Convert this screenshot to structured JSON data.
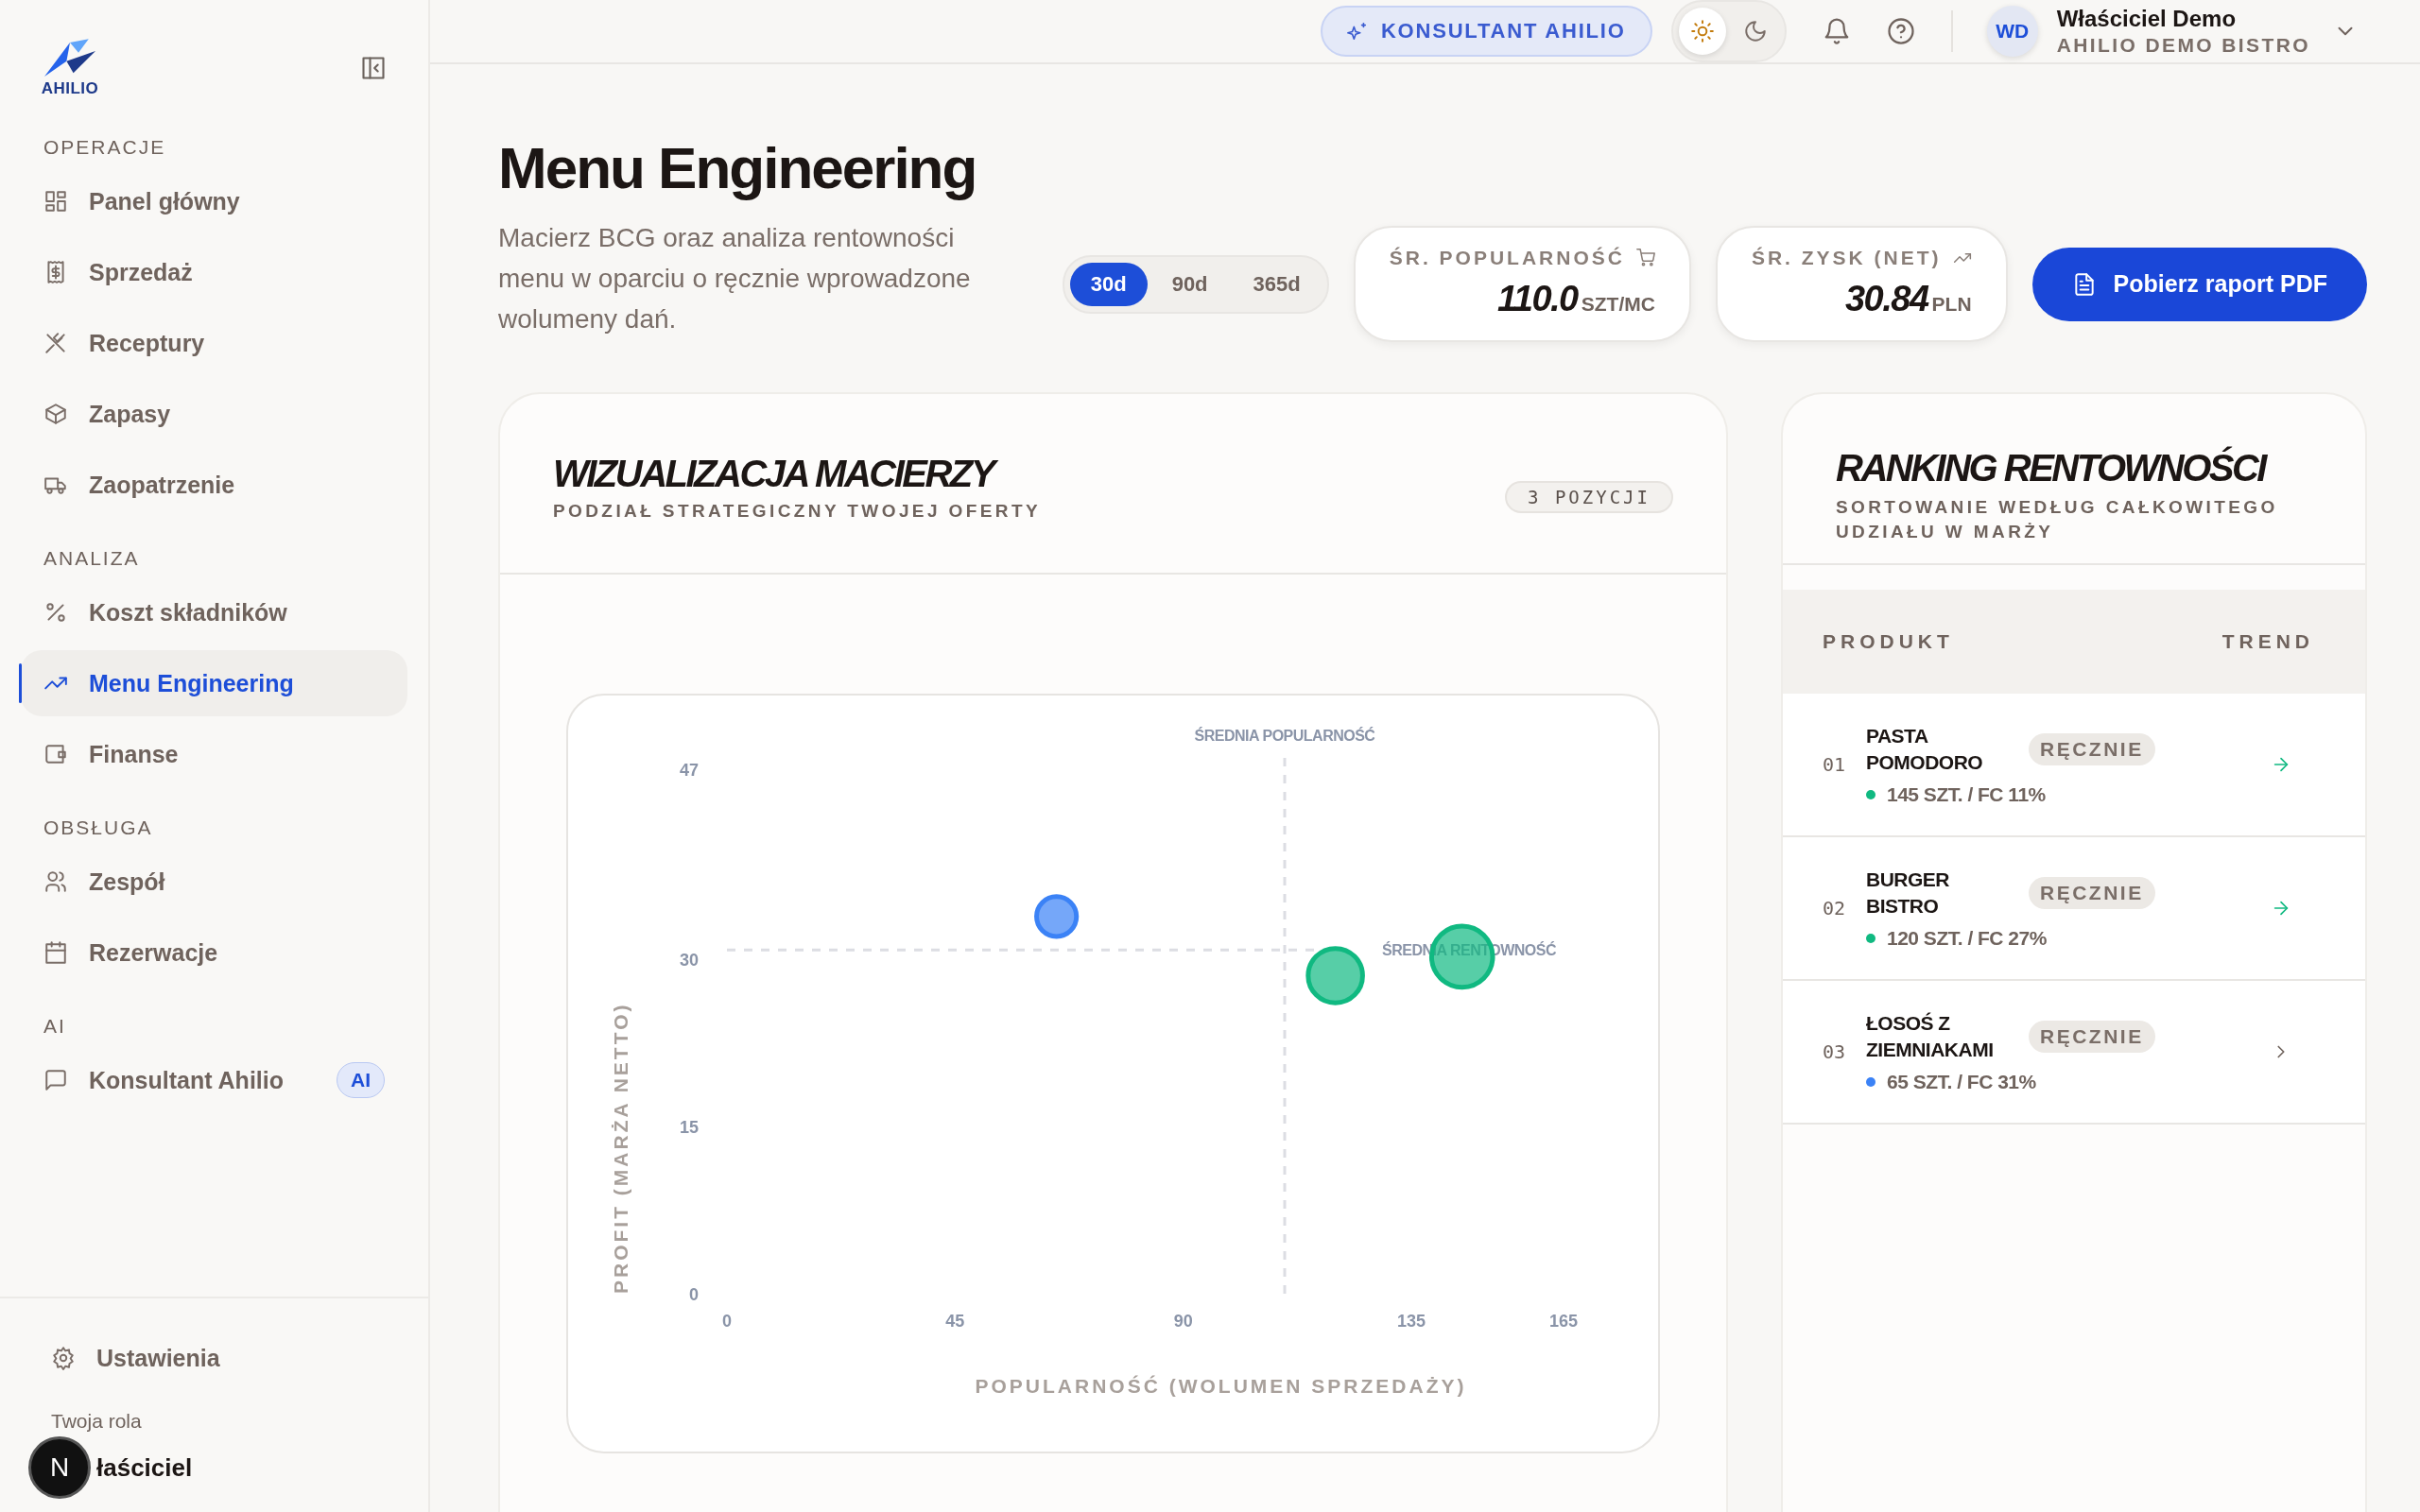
{
  "sidebar": {
    "logo": "AHILIO",
    "sections": [
      {
        "title": "OPERACJE",
        "items": [
          {
            "label": "Panel główny",
            "selected": false
          },
          {
            "label": "Sprzedaż",
            "selected": false
          },
          {
            "label": "Receptury",
            "selected": false
          },
          {
            "label": "Zapasy",
            "selected": false
          },
          {
            "label": "Zaopatrzenie",
            "selected": false
          }
        ]
      },
      {
        "title": "ANALIZA",
        "items": [
          {
            "label": "Koszt składników",
            "selected": false
          },
          {
            "label": "Menu Engineering",
            "selected": true
          },
          {
            "label": "Finanse",
            "selected": false
          }
        ]
      },
      {
        "title": "OBSŁUGA",
        "items": [
          {
            "label": "Zespół",
            "selected": false
          },
          {
            "label": "Rezerwacje",
            "selected": false
          }
        ]
      },
      {
        "title": "AI",
        "items": [
          {
            "label": "Konsultant Ahilio",
            "selected": false,
            "badge": "AI"
          }
        ]
      }
    ],
    "settings": "Ustawienia",
    "role_label": "Twoja rola",
    "role_value": "łaściciel",
    "dev_badge": "N"
  },
  "header": {
    "consultant_button": "KONSULTANT AHILIO",
    "theme_toggle": [
      {
        "kind": "light",
        "selected": true
      },
      {
        "kind": "dark",
        "selected": false
      }
    ],
    "user": {
      "initials": "WD",
      "name": "Właściciel Demo",
      "org": "AHILIO DEMO BISTRO"
    }
  },
  "page": {
    "title": "Menu Engineering",
    "description": "Macierz BCG oraz analiza rentowności menu w oparciu o ręcznie wprowadzone wolumeny dań.",
    "periods": [
      {
        "label": "30d",
        "selected": true
      },
      {
        "label": "90d",
        "selected": false
      },
      {
        "label": "365d",
        "selected": false
      }
    ],
    "stats": [
      {
        "label": "ŚR. POPULARNOŚĆ",
        "value": "110.0",
        "unit": "SZT/MC"
      },
      {
        "label": "ŚR. ZYSK (NET)",
        "value": "30.84",
        "unit": "PLN"
      }
    ],
    "download_button": "Pobierz raport PDF"
  },
  "matrix": {
    "title": "WIZUALIZACJA MACIERZY",
    "subtitle": "PODZIAŁ STRATEGICZNY TWOJEJ OFERTY",
    "count": "3 POZYCJI",
    "chart_data": {
      "type": "scatter",
      "xlabel": "POPULARNOŚĆ (WOLUMEN SPRZEDAŻY)",
      "ylabel": "PROFIT (MARŻA NETTO)",
      "xlim": [
        0,
        165
      ],
      "ylim": [
        0,
        47
      ],
      "xticks": [
        0,
        45,
        90,
        135,
        165
      ],
      "yticks": [
        0,
        15,
        30,
        47
      ],
      "series": [
        {
          "color": "#3b82f6",
          "x": [
            65
          ],
          "values": [
            33.8
          ]
        },
        {
          "color": "#10b981",
          "x": [
            120,
            145
          ],
          "values": [
            28.5,
            30.2
          ]
        }
      ],
      "ref_lines": [
        {
          "axis": "x",
          "value": 110,
          "label": "ŚREDNIA POPULARNOŚĆ"
        },
        {
          "axis": "y",
          "value": 30.8,
          "label": "ŚREDNIA RENTOWNOŚĆ"
        }
      ]
    }
  },
  "ranking": {
    "title": "RANKING RENTOWNOŚCI",
    "subtitle": "SORTOWANIE WEDŁUG CAŁKOWITEGO UDZIAŁU W MARŻY",
    "columns": [
      "PRODUKT",
      "TREND"
    ],
    "rows": [
      {
        "rank": "01",
        "name": "PASTA POMODORO",
        "badge": "RĘCZNIE",
        "meta": "145 SZT. / FC 11%",
        "color": "#10b981",
        "kind": "rising"
      },
      {
        "rank": "02",
        "name": "BURGER BISTRO",
        "badge": "RĘCZNIE",
        "meta": "120 SZT. / FC 27%",
        "color": "#10b981",
        "kind": "rising"
      },
      {
        "rank": "03",
        "name": "ŁOSOŚ Z ZIEMNIAKAMI",
        "badge": "RĘCZNIE",
        "meta": "65 SZT. / FC 31%",
        "color": "#3b82f6",
        "kind": "steady"
      }
    ]
  }
}
